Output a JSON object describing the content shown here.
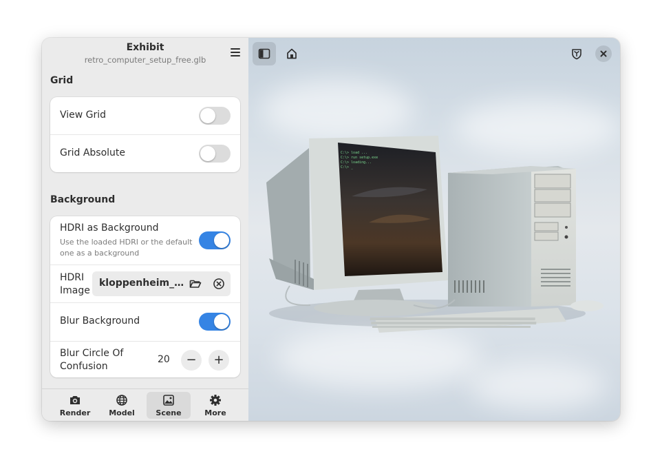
{
  "window": {
    "title": "Exhibit",
    "subtitle": "retro_computer_setup_free.glb"
  },
  "grid_section": {
    "title": "Grid",
    "view_grid": {
      "label": "View Grid",
      "enabled": false
    },
    "grid_absolute": {
      "label": "Grid Absolute",
      "enabled": false
    }
  },
  "background_section": {
    "title": "Background",
    "hdri_bg": {
      "label": "HDRI as Background",
      "description": "Use the loaded HDRI or the default one as a background",
      "enabled": true
    },
    "hdri_image": {
      "label_line1": "HDRI",
      "label_line2": "Image",
      "file": "kloppenheim_0…"
    },
    "blur_bg": {
      "label": "Blur Background",
      "enabled": true
    },
    "blur_coc": {
      "label_line1": "Blur Circle Of",
      "label_line2": "Confusion",
      "value": "20",
      "minus": "−",
      "plus": "+"
    }
  },
  "tabs": [
    {
      "label": "Render",
      "icon": "camera-icon"
    },
    {
      "label": "Model",
      "icon": "globe-icon"
    },
    {
      "label": "Scene",
      "icon": "image-icon",
      "active": true
    },
    {
      "label": "More",
      "icon": "gear-icon"
    }
  ],
  "colors": {
    "accent": "#3584e4",
    "sidebar_bg": "#ebebeb",
    "card_bg": "#ffffff"
  },
  "viewport": {
    "terminal_lines": [
      "C:\\> load ...",
      "C:\\> run setup.exe",
      "C:\\> loading...",
      "C:\\> _"
    ]
  }
}
